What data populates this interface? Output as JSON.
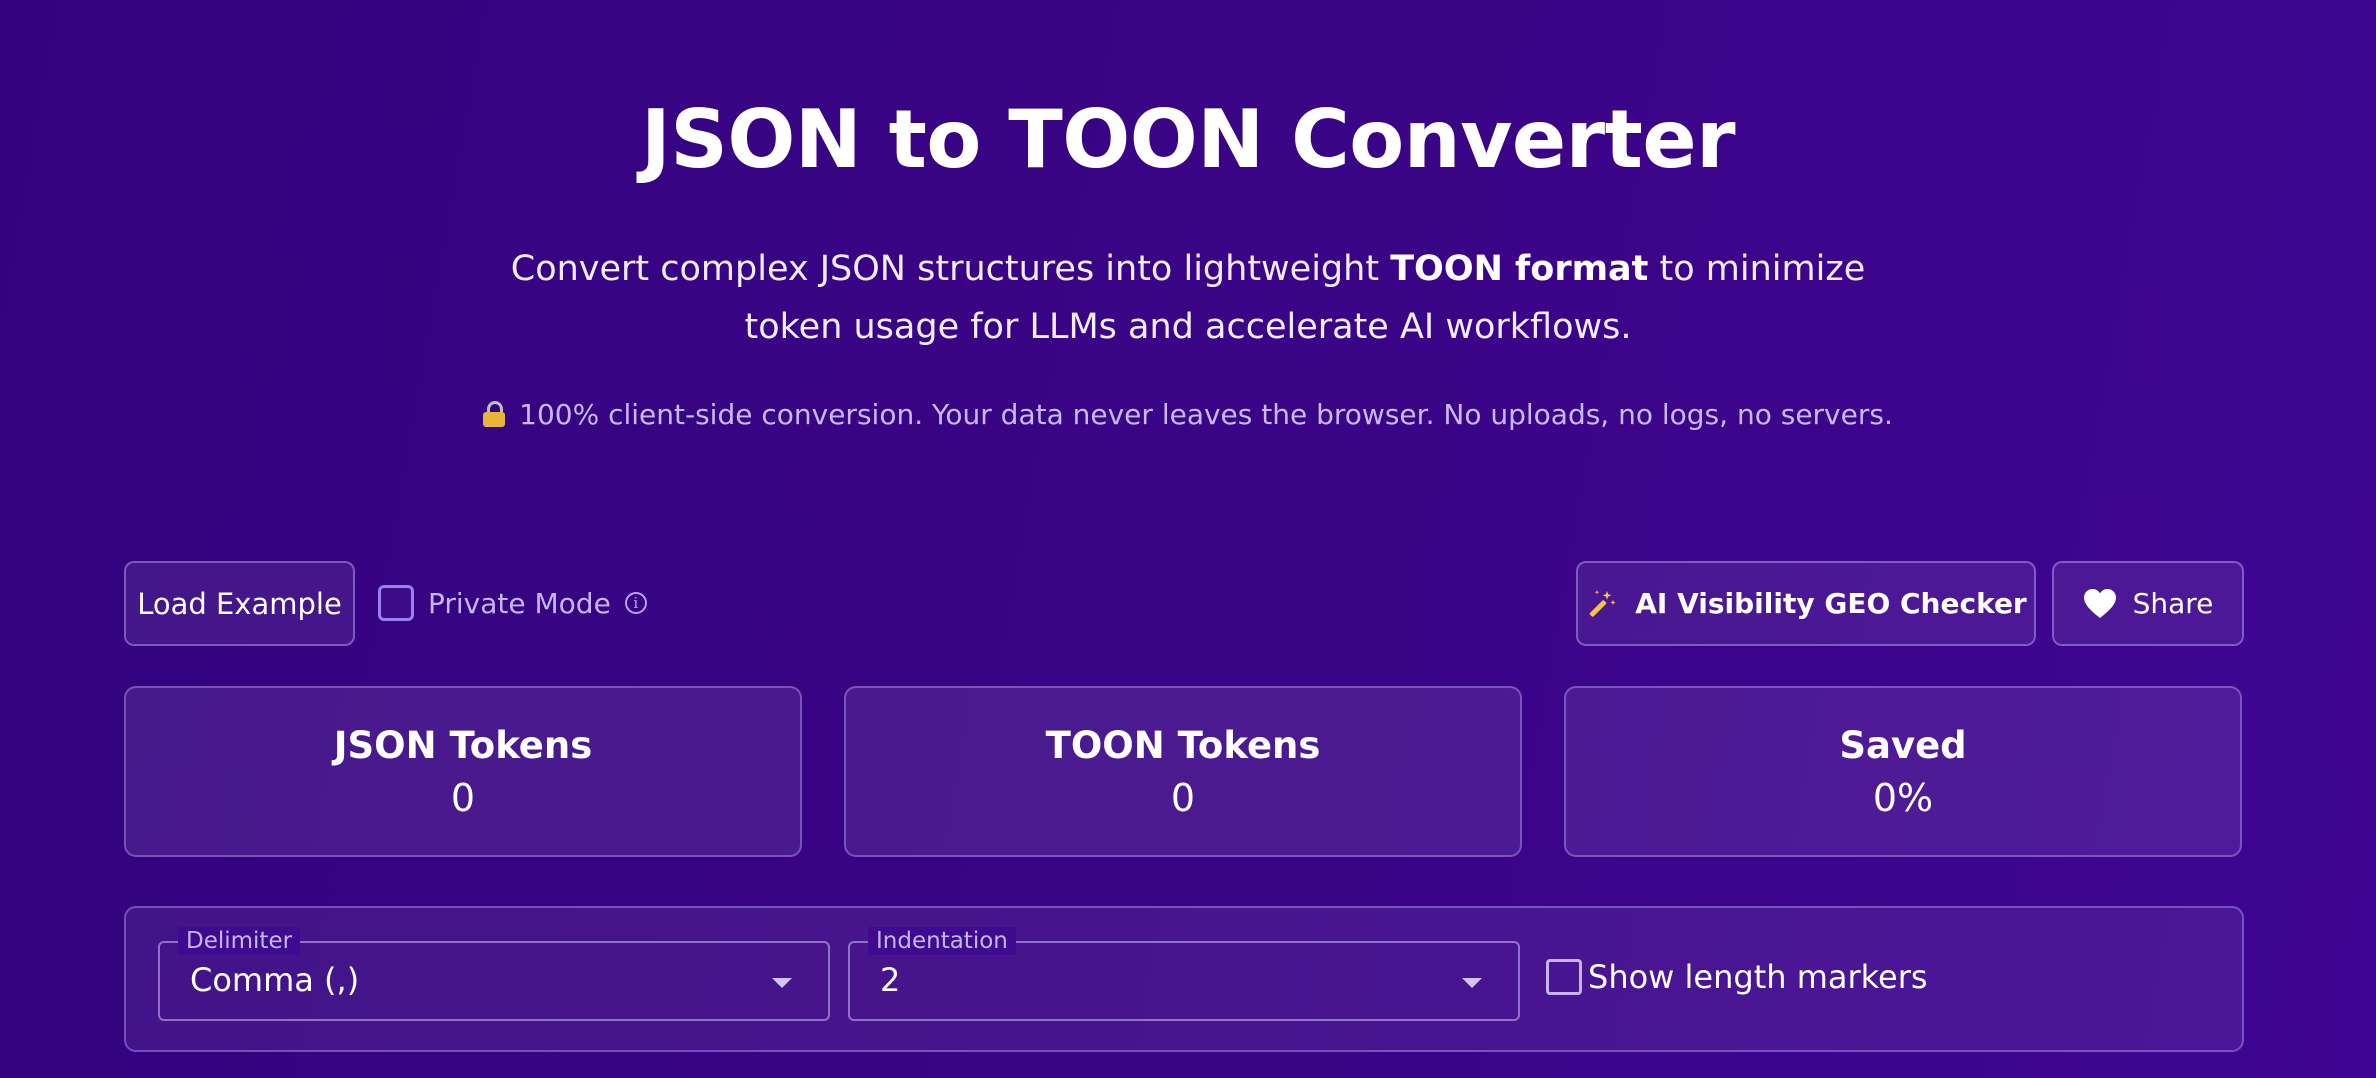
{
  "header": {
    "title": "JSON to TOON Converter",
    "subtitle_before": "Convert complex JSON structures into lightweight ",
    "subtitle_bold": "TOON format",
    "subtitle_after": " to minimize token usage for LLMs and accelerate AI workflows.",
    "privacy_note": "100% client-side conversion. Your data never leaves the browser. No uploads, no logs, no servers.",
    "privacy_icon": "lock-icon"
  },
  "toolbar": {
    "load_example_label": "Load Example",
    "private_mode_label": "Private Mode",
    "private_mode_checked": false,
    "info_icon": "info-icon",
    "geo_checker_label": "AI Visibility GEO Checker",
    "geo_checker_icon": "magic-wand-icon",
    "share_label": "Share",
    "share_icon": "heart-icon"
  },
  "stats": {
    "json_tokens_label": "JSON Tokens",
    "json_tokens_value": "0",
    "toon_tokens_label": "TOON Tokens",
    "toon_tokens_value": "0",
    "saved_label": "Saved",
    "saved_value": "0%"
  },
  "options": {
    "delimiter_label": "Delimiter",
    "delimiter_value": "Comma (,)",
    "indentation_label": "Indentation",
    "indentation_value": "2",
    "length_markers_label": "Show length markers",
    "length_markers_checked": false
  },
  "colors": {
    "background_start": "#33037f",
    "background_end": "#3f0592",
    "accent_border": "#9a7ff0",
    "wand_icon": "#f5c542"
  }
}
